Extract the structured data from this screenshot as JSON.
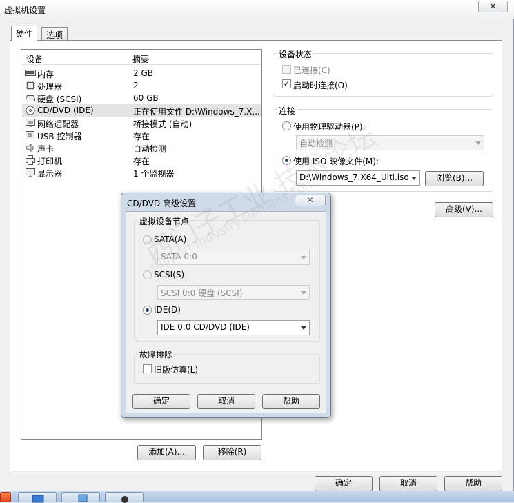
{
  "window": {
    "title": "虚拟机设置",
    "close_glyph": "✕"
  },
  "tabs": [
    {
      "label": "硬件",
      "active": true
    },
    {
      "label": "选项",
      "active": false
    }
  ],
  "device_list": {
    "col_device": "设备",
    "col_summary": "摘要",
    "rows": [
      {
        "icon": "memory-icon",
        "name": "内存",
        "summary": "2 GB"
      },
      {
        "icon": "cpu-icon",
        "name": "处理器",
        "summary": "2"
      },
      {
        "icon": "hard-disk-icon",
        "name": "硬盘 (SCSI)",
        "summary": "60 GB"
      },
      {
        "icon": "cd-dvd-icon",
        "name": "CD/DVD (IDE)",
        "summary": "正在使用文件 D:\\Windows_7.X..."
      },
      {
        "icon": "network-icon",
        "name": "网络适配器",
        "summary": "桥接模式 (自动)"
      },
      {
        "icon": "usb-icon",
        "name": "USB 控制器",
        "summary": "存在"
      },
      {
        "icon": "speaker-icon",
        "name": "声卡",
        "summary": "自动检测"
      },
      {
        "icon": "printer-icon",
        "name": "打印机",
        "summary": "存在"
      },
      {
        "icon": "monitor-icon",
        "name": "显示器",
        "summary": "1 个监视器"
      }
    ],
    "selected_index": 3
  },
  "buttons": {
    "add": "添加(A)...",
    "remove": "移除(R)",
    "ok": "确定",
    "cancel": "取消",
    "help": "帮助"
  },
  "device_status": {
    "title": "设备状态",
    "connected": "已连接(C)",
    "connect_at_power_on": "启动时连接(O)",
    "connected_checked": false,
    "connect_at_power_on_checked": true,
    "check_glyph": "✓"
  },
  "connection": {
    "title": "连接",
    "use_physical_drive": "使用物理驱动器(P):",
    "physical_drive_value": "自动检测",
    "use_iso": "使用 ISO 映像文件(M):",
    "iso_value": "D:\\Windows_7.X64_Ulti.iso",
    "browse": "浏览(B)...",
    "selected": "iso"
  },
  "advanced_button": "高级(V)...",
  "advanced_dialog": {
    "title": "CD/DVD 高级设置",
    "close_glyph": "✕",
    "node_group": "虚拟设备节点",
    "sata_label": "SATA(A)",
    "sata_value": "SATA 0:0",
    "scsi_label": "SCSI(S)",
    "scsi_value": "SCSI 0:0   硬盘 (SCSI)",
    "ide_label": "IDE(D)",
    "ide_value": "IDE 0:0    CD/DVD (IDE)",
    "selected": "ide",
    "troubleshoot_group": "故障排除",
    "legacy_emulation": "旧版仿真(L)",
    "legacy_checked": false,
    "ok": "确定",
    "cancel": "取消",
    "help": "帮助"
  },
  "watermark": {
    "main": "西门子工业 技术论坛",
    "sub": "support.industry.siemens.com/cs"
  }
}
